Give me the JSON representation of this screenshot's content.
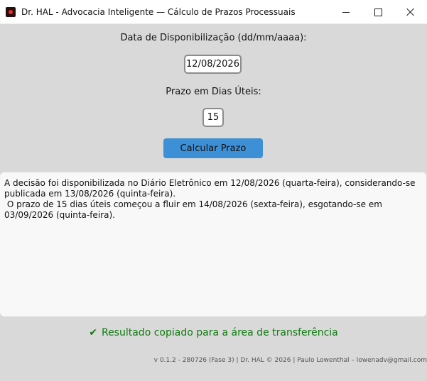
{
  "window": {
    "title": "Dr. HAL - Advocacia Inteligente — Cálculo de Prazos Processuais",
    "icon": "app-logo-icon"
  },
  "form": {
    "date_label": "Data de Disponibilização (dd/mm/aaaa):",
    "date_value": "12/08/2026",
    "prazo_label": "Prazo em Dias Úteis:",
    "prazo_value": "15",
    "calc_button": "Calcular Prazo"
  },
  "result": {
    "text": "A decisão foi disponibilizada no Diário Eletrônico em 12/08/2026 (quarta-feira), considerando-se publicada em 13/08/2026 (quinta-feira).\n O prazo de 15 dias úteis começou a fluir em 14/08/2026 (sexta-feira), esgotando-se em 03/09/2026 (quinta-feira)."
  },
  "status": {
    "check": "✔",
    "text": "Resultado copiado para a área de transferência",
    "color": "#117a11"
  },
  "footer": {
    "text": "v 0.1.2 - 280726 (Fase 3) | Dr. HAL © 2026 | Paulo Lowenthal – lowenadv@gmail.com"
  },
  "colors": {
    "background": "#d9d9d9",
    "button": "#3d8fd6",
    "result_bg": "#f8f8f8"
  }
}
